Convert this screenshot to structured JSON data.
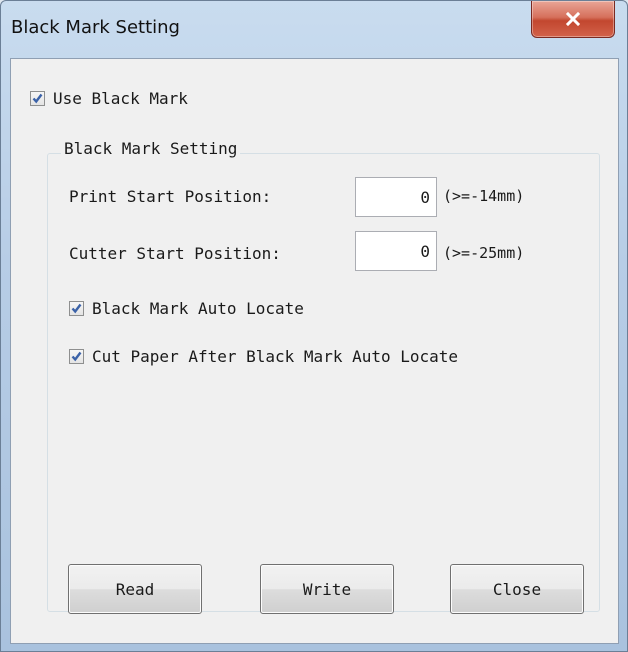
{
  "window": {
    "title": "Black Mark Setting",
    "close_icon": "close-icon"
  },
  "use_black_mark": {
    "label": "Use Black Mark",
    "checked": true
  },
  "group": {
    "legend": "Black Mark Setting",
    "print_start": {
      "label": "Print Start Position:",
      "value": "0",
      "hint": "(>=-14mm)"
    },
    "cutter_start": {
      "label": "Cutter Start Position:",
      "value": "0",
      "hint": "(>=-25mm)"
    },
    "auto_locate": {
      "label": "Black Mark Auto Locate",
      "checked": true
    },
    "cut_after_locate": {
      "label": "Cut Paper After Black Mark Auto Locate",
      "checked": true
    }
  },
  "buttons": {
    "read": "Read",
    "write": "Write",
    "close": "Close"
  },
  "colors": {
    "check_mark": "#3b62a8",
    "close_button": "#c2472f"
  }
}
